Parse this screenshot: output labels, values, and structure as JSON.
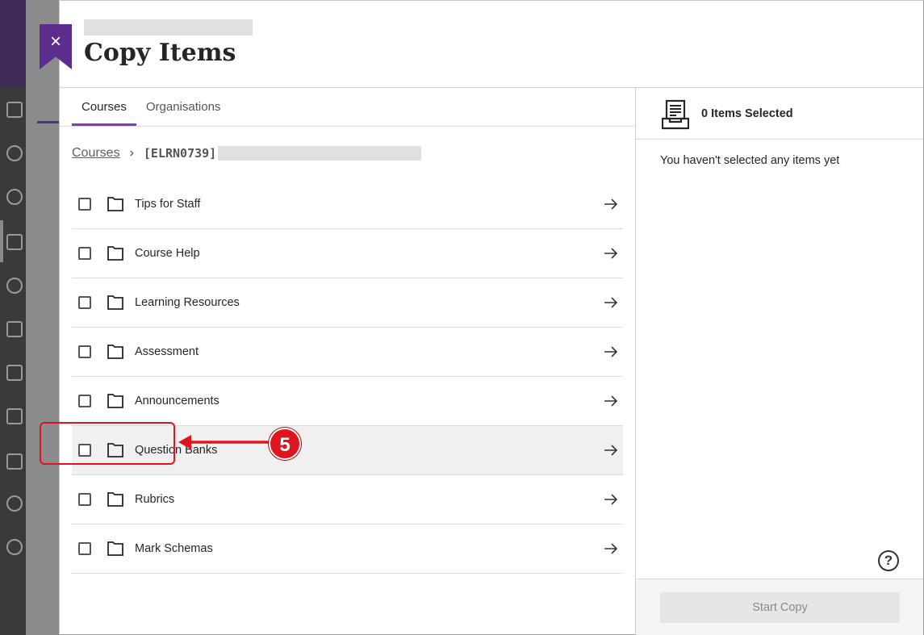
{
  "modal": {
    "title": "Copy Items",
    "close_label": "×"
  },
  "tabs": [
    {
      "label": "Courses"
    },
    {
      "label": "Organisations"
    }
  ],
  "breadcrumb": {
    "root": "Courses",
    "current": "[ELRN0739]"
  },
  "items": [
    {
      "label": "Tips for Staff"
    },
    {
      "label": "Course Help"
    },
    {
      "label": "Learning Resources"
    },
    {
      "label": "Assessment"
    },
    {
      "label": "Announcements"
    },
    {
      "label": "Question Banks"
    },
    {
      "label": "Rubrics"
    },
    {
      "label": "Mark Schemas"
    }
  ],
  "annotation": {
    "number": "5",
    "color": "#e0141e"
  },
  "selection": {
    "count_label": "0 Items Selected",
    "empty_message": "You haven't selected any items yet",
    "start_button": "Start Copy",
    "help_label": "?"
  },
  "colors": {
    "accent": "#8a3ab9",
    "close_flag": "#5c2d8c"
  }
}
